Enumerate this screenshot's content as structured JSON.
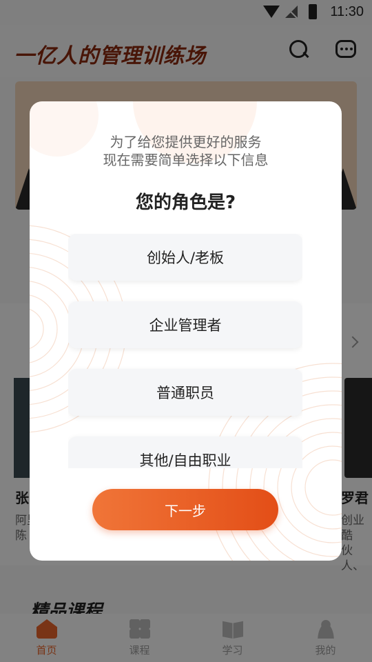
{
  "status_bar": {
    "time": "11:30"
  },
  "header": {
    "title": "一亿人的管理训练场",
    "search_icon": "search-icon",
    "message_icon": "message-icon"
  },
  "teachers": {
    "left": {
      "name": "张",
      "desc_line1": "阿里",
      "desc_line2": "陈"
    },
    "right": {
      "name": "罗君",
      "desc_line1": "创业酷",
      "desc_line2": "伙人、"
    }
  },
  "section_quality": {
    "title": "精品课程"
  },
  "bottom_nav": {
    "items": [
      {
        "label": "首页",
        "icon": "home-icon",
        "active": true
      },
      {
        "label": "课程",
        "icon": "grid-icon",
        "active": false
      },
      {
        "label": "学习",
        "icon": "book-icon",
        "active": false
      },
      {
        "label": "我的",
        "icon": "person-icon",
        "active": false
      }
    ]
  },
  "dialog": {
    "intro_line1": "为了给您提供更好的服务",
    "intro_line2": "现在需要简单选择以下信息",
    "question": "您的角色是?",
    "options": [
      {
        "label": "创始人/老板"
      },
      {
        "label": "企业管理者"
      },
      {
        "label": "普通职员"
      },
      {
        "label": "其他/自由职业"
      }
    ],
    "next_label": "下一步"
  },
  "colors": {
    "accent": "#e8652b",
    "button_start": "#f07538",
    "button_end": "#e34e17"
  }
}
